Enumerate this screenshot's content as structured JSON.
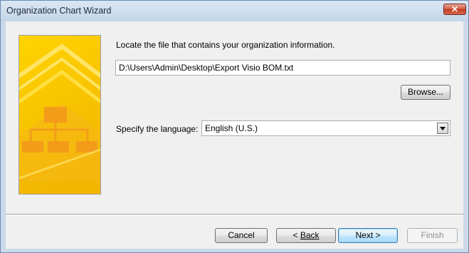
{
  "window": {
    "title": "Organization Chart Wizard",
    "close_label": "✕"
  },
  "main": {
    "file_prompt": "Locate the file that contains your organization information.",
    "file_path": "D:\\Users\\Admin\\Desktop\\Export Visio BOM.txt",
    "browse_label": "Browse...",
    "language_label": "Specify the language:",
    "language_value": "English (U.S.)"
  },
  "footer": {
    "cancel_label": "Cancel",
    "back_label": "Back",
    "next_label": "Next",
    "finish_label": "Finish"
  },
  "colors": {
    "banner_yellow": "#f5c400",
    "banner_orange": "#f6a31a",
    "accent_blue": "#3c7fb1"
  }
}
